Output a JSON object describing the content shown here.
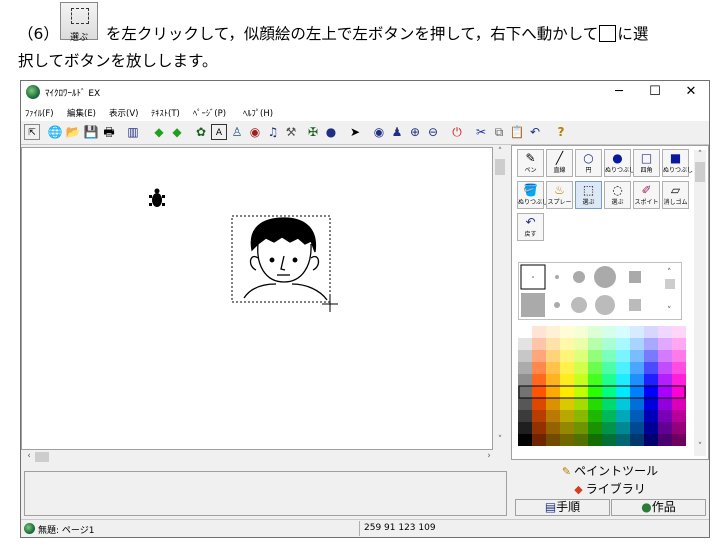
{
  "instruction": {
    "line1_pre": "（6）",
    "line1_post": "を左クリックして，似顔絵の左上で左ボタンを押して，右下へ動かして",
    "line1_end": "に選",
    "line2": "択してボタンを放しします。",
    "button_image_label": "選ぶ"
  },
  "window": {
    "title": "ﾏｲｸﾛﾜｰﾙﾄﾞ EX",
    "controls": {
      "minimize": "─",
      "maximize": "☐",
      "close": "✕"
    }
  },
  "menu": [
    "ﾌｧｲﾙ(F)",
    "編集(E)",
    "表示(V)",
    "ﾃｷｽﾄ(T)",
    "ﾍﾟｰｼﾞ(P)",
    "ﾍﾙﾌﾟ(H)"
  ],
  "toolbar_icons": [
    "mode-icon",
    "globe-icon",
    "open-icon",
    "save-icon",
    "print-icon",
    "book-icon",
    "arrow-left-icon",
    "arrow-right-icon",
    "turtle-icon",
    "text-a-icon",
    "person-icon",
    "eye-icon",
    "music-icon",
    "wrench-icon",
    "camera-icon",
    "globe2-icon",
    "pointer-icon",
    "eye2-icon",
    "stamp-icon",
    "zoom-in-icon",
    "zoom-out-icon",
    "stop-icon",
    "cut-icon",
    "copy-icon",
    "paste-icon",
    "undo-icon",
    "help-icon"
  ],
  "paint_tools": [
    {
      "label": "ペン",
      "glyph": "✎"
    },
    {
      "label": "直線",
      "glyph": "╱"
    },
    {
      "label": "円",
      "glyph": "○"
    },
    {
      "label": "ぬりつぶし",
      "glyph": "●"
    },
    {
      "label": "四角",
      "glyph": "□"
    },
    {
      "label": "ぬりつぶし",
      "glyph": "■"
    },
    {
      "label": "ぬりつぶし",
      "glyph": "🪣"
    },
    {
      "label": "スプレー",
      "glyph": "♨"
    },
    {
      "label": "選ぶ",
      "glyph": "⬚"
    },
    {
      "label": "選ぶ",
      "glyph": "◌"
    },
    {
      "label": "スポイト",
      "glyph": "✐"
    },
    {
      "label": "消しゴム",
      "glyph": "▱"
    },
    {
      "label": "戻す",
      "glyph": "↶"
    }
  ],
  "panel_tabs": {
    "paint": "ペイントツール",
    "library": "ライブラリ",
    "steps": "手順",
    "works": "作品"
  },
  "status": {
    "left": "無題: ページ1",
    "coords": "259 91 123 109"
  },
  "colors": {
    "accent_blue": "#0a1a9c",
    "hair": "#000000"
  }
}
